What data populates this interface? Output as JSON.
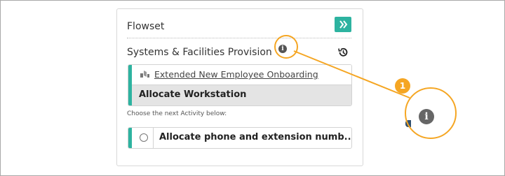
{
  "panel": {
    "title": "Flowset",
    "toggle_icon": "double-chevron-right-icon",
    "section_title": "Systems & Facilities Provision",
    "info_icon": "info-icon",
    "history_icon": "history-icon"
  },
  "current_flow": {
    "link_text": "Extended New Employee Onboarding",
    "active_activity": "Allocate Workstation"
  },
  "next": {
    "hint": "Choose the next Activity below:",
    "options": [
      {
        "label": "Allocate phone and extension numb..."
      }
    ]
  },
  "callout": {
    "step_number": "1",
    "accent_color": "#f5a623"
  },
  "colors": {
    "teal": "#2db3a0",
    "callout": "#f5a623"
  }
}
